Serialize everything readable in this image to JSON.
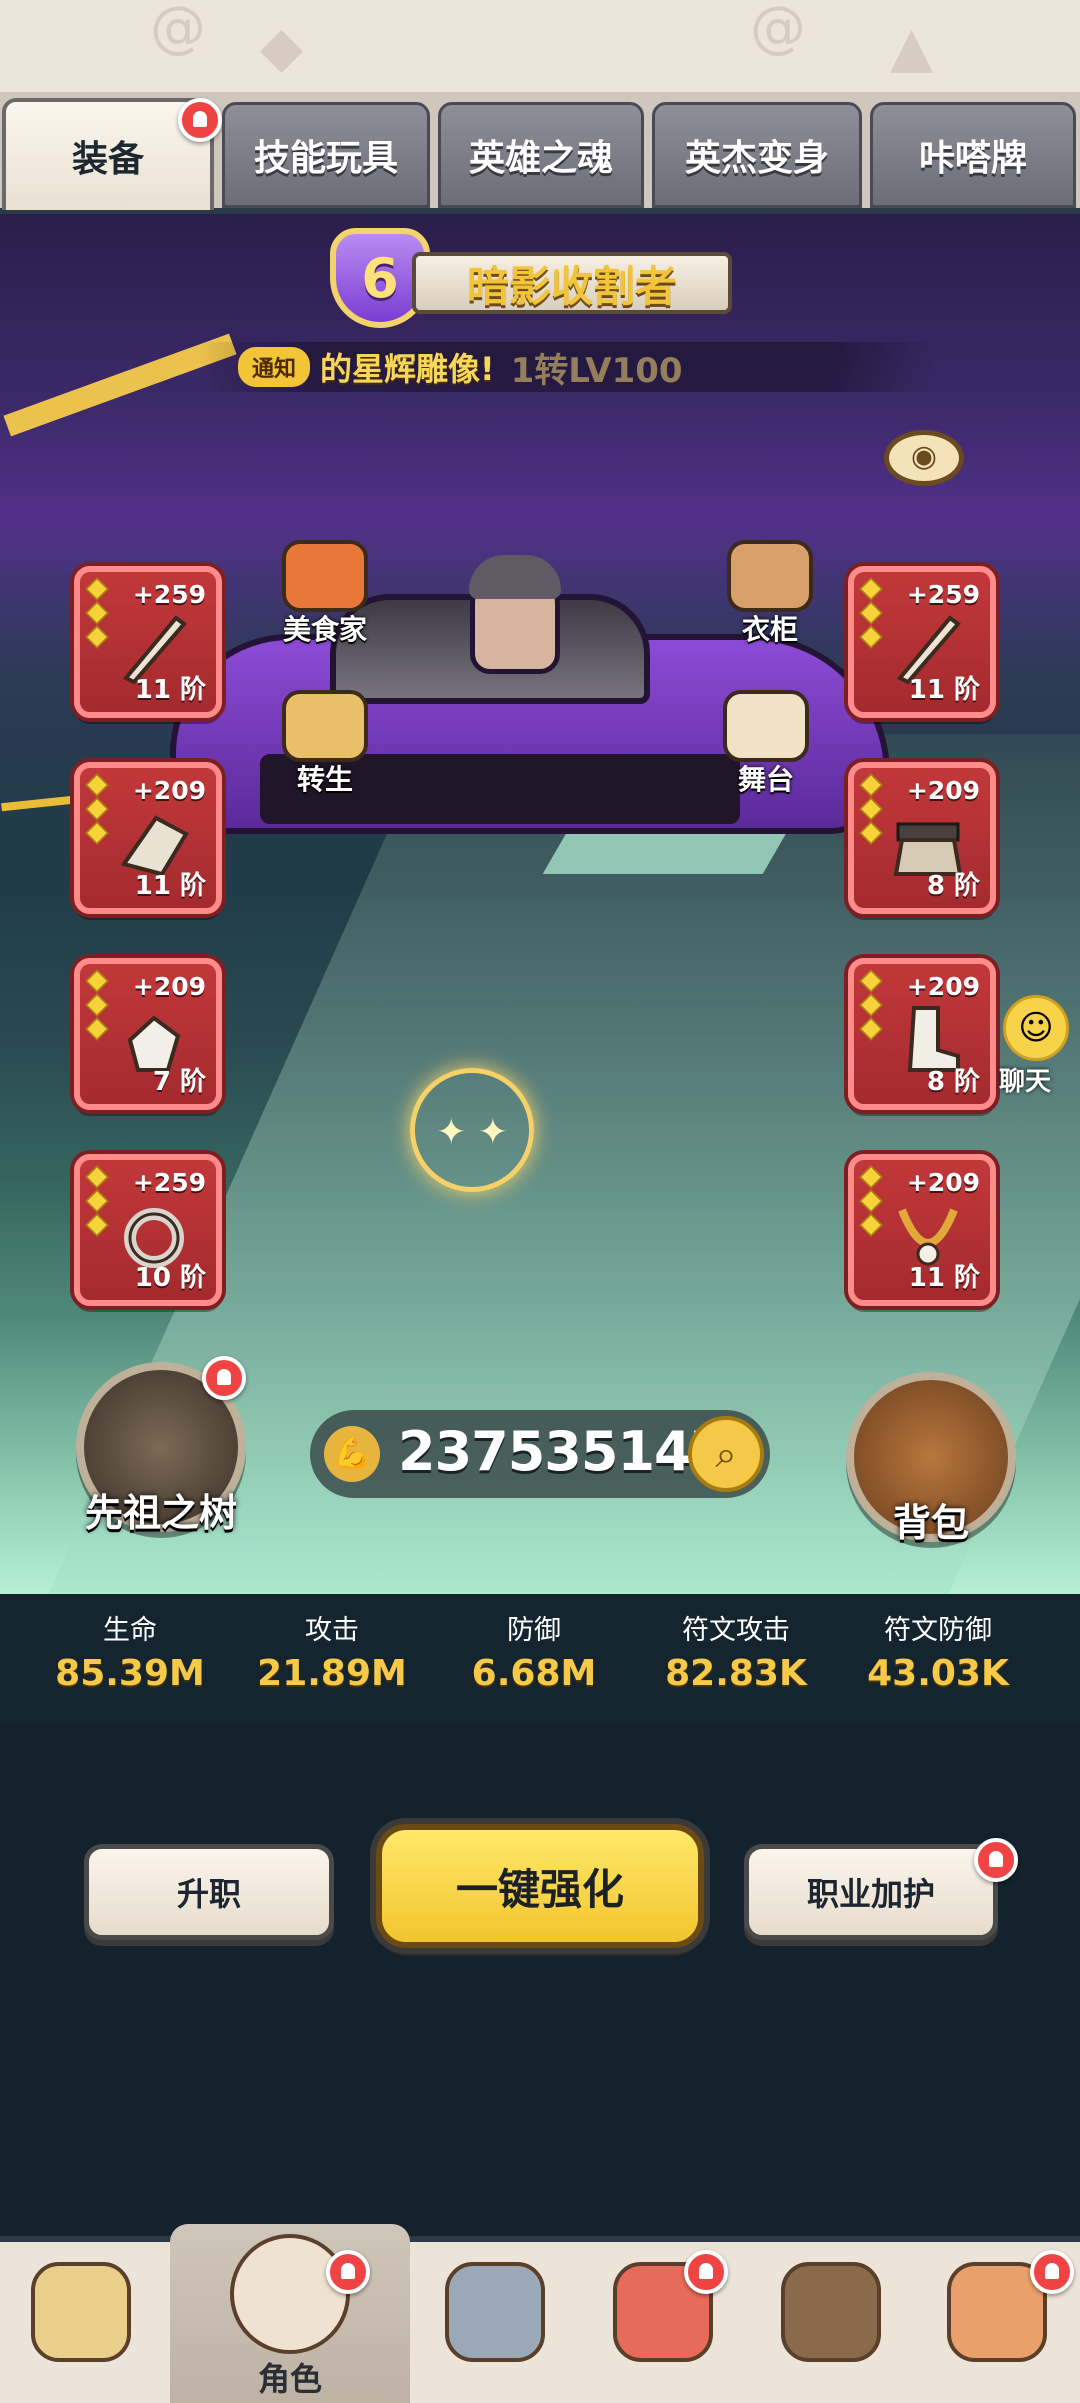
{
  "tabs": [
    {
      "label": "装备",
      "active": true,
      "badge": true
    },
    {
      "label": "技能玩具"
    },
    {
      "label": "英雄之魂"
    },
    {
      "label": "英杰变身"
    },
    {
      "label": "咔嗒牌"
    }
  ],
  "rank": {
    "level": "6",
    "title": "暗影收割者"
  },
  "notice": {
    "tag": "通知",
    "text": "的星辉雕像!",
    "extra": "1转LV100"
  },
  "left_slots": [
    {
      "plus": "+259",
      "tier": "11 阶",
      "icon": "spear-icon"
    },
    {
      "plus": "+209",
      "tier": "11 阶",
      "icon": "shoulder-armor-icon"
    },
    {
      "plus": "+209",
      "tier": "7 阶",
      "icon": "gauntlet-icon"
    },
    {
      "plus": "+259",
      "tier": "10 阶",
      "icon": "ring-icon"
    }
  ],
  "right_slots": [
    {
      "plus": "+259",
      "tier": "11 阶",
      "icon": "spear-icon"
    },
    {
      "plus": "+209",
      "tier": "8 阶",
      "icon": "belt-icon"
    },
    {
      "plus": "+209",
      "tier": "8 阶",
      "icon": "boots-icon"
    },
    {
      "plus": "+209",
      "tier": "11 阶",
      "icon": "necklace-icon"
    }
  ],
  "scene_buttons": {
    "gourmet": "美食家",
    "wardrobe": "衣柜",
    "rebirth": "转生",
    "stage": "舞台"
  },
  "chat_label": "聊天",
  "ancestor_tree": "先祖之树",
  "power": "237535147",
  "bag": "背包",
  "stats": [
    {
      "name": "生命",
      "value": "85.39M"
    },
    {
      "name": "攻击",
      "value": "21.89M"
    },
    {
      "name": "防御",
      "value": "6.68M"
    },
    {
      "name": "符文攻击",
      "value": "82.83K"
    },
    {
      "name": "符文防御",
      "value": "43.03K"
    }
  ],
  "actions": {
    "promote": "升职",
    "one_key": "一键强化",
    "career_guard": "职业加护"
  },
  "bottom_nav": [
    {
      "label": "",
      "icon": "lion-hero-icon"
    },
    {
      "label": "角色",
      "icon": "character-avatar-icon",
      "active": true
    },
    {
      "label": "",
      "icon": "weapon-icon"
    },
    {
      "label": "",
      "icon": "pet-dino-icon"
    },
    {
      "label": "",
      "icon": "raccoon-shop-icon"
    },
    {
      "label": "",
      "icon": "totem-icon"
    }
  ],
  "colors": {
    "slot_red": "#c2383a",
    "stat_gold": "#f7c948",
    "primary_yellow": "#f2c52f",
    "badge_red": "#f04343"
  }
}
